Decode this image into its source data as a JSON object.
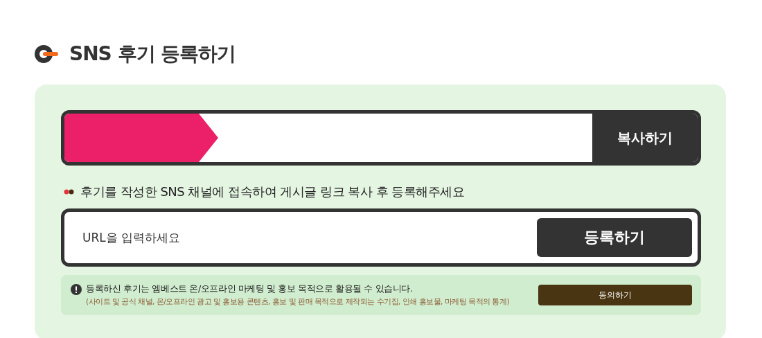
{
  "title": "SNS 후기 등록하기",
  "copy_bar": {
    "button": "복사하기"
  },
  "instruction": "후기를 작성한 SNS 채널에 접속하여 게시글 링크 복사 후 등록해주세요",
  "url_field": {
    "placeholder": "URL을 입력하세요",
    "button": "등록하기"
  },
  "notice": {
    "text": "등록하신 후기는 엠베스트 온/오프라인 마케팅 및 홍보 목적으로 활용될 수 있습니다.",
    "subtext": "(사이트 및 공식 채널, 온/오프라인 광고 및 홍보용 콘텐츠, 홍보 및 판매 목적으로 제작되는 수기집, 인쇄 홍보물, 마케팅 목적의 통계)",
    "button": "동의하기"
  }
}
